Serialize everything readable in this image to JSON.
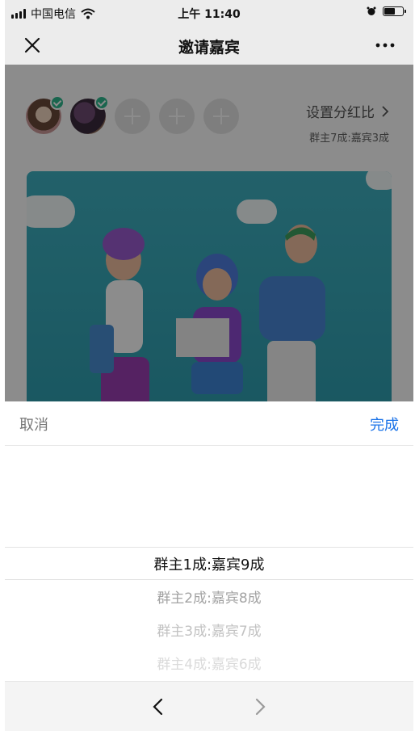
{
  "status_bar": {
    "carrier": "中国电信",
    "time": "上午 11:40"
  },
  "nav": {
    "title": "邀请嘉宾"
  },
  "header": {
    "split_link": "设置分红比",
    "split_summary": "群主7成:嘉宾3成"
  },
  "picker": {
    "cancel_label": "取消",
    "done_label": "完成",
    "selected": "群主1成:嘉宾9成",
    "options": [
      "群主2成:嘉宾8成",
      "群主3成:嘉宾7成",
      "群主4成:嘉宾6成"
    ]
  },
  "colors": {
    "accent": "#1a73e8",
    "check": "#2fb98f",
    "banner": "#3fb1c1"
  },
  "icons": [
    "signal-icon",
    "wifi-icon",
    "alarm-icon",
    "battery-icon",
    "close-icon",
    "more-icon",
    "check-icon",
    "add-icon",
    "chevron-right-icon",
    "chevron-left-icon"
  ]
}
